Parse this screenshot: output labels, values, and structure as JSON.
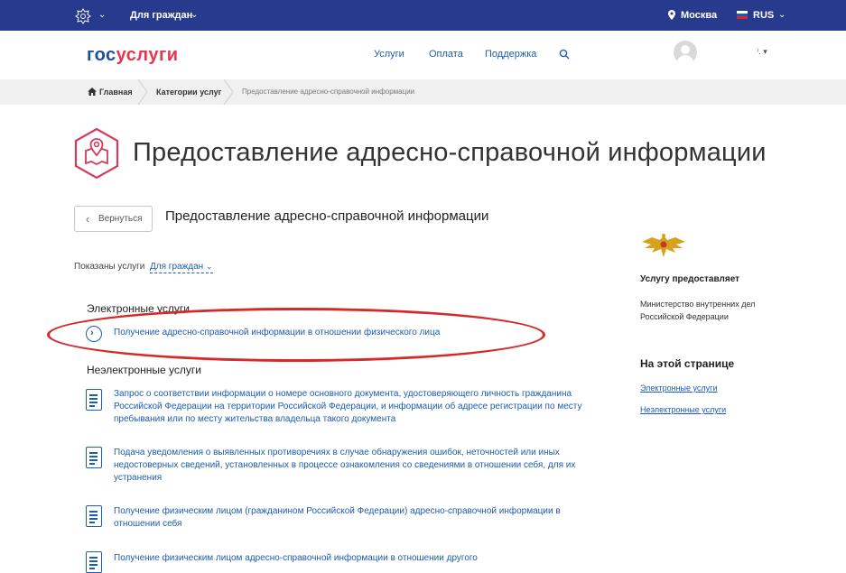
{
  "topbar": {
    "for_citizens": "Для граждан",
    "location": "Москва",
    "language": "RUS"
  },
  "header": {
    "logo_part1": "гос",
    "logo_part2": "услуги",
    "nav": [
      "Услуги",
      "Оплата",
      "Поддержка"
    ],
    "user_menu_label": "⁾."
  },
  "breadcrumb": {
    "home": "Главная",
    "categories": "Категории услуг",
    "current": "Предоставление адресно-справочной информации"
  },
  "page": {
    "title": "Предоставление адресно-справочной информации",
    "back_label": "Вернуться",
    "subtitle": "Предоставление адресно-справочной информации",
    "filter_label": "Показаны услуги",
    "filter_value": "Для граждан"
  },
  "services": {
    "electronic_heading": "Электронные услуги",
    "electronic": [
      "Получение адресно-справочной информации в отношении физического лица"
    ],
    "non_electronic_heading": "Неэлектронные услуги",
    "non_electronic": [
      "Запрос о соответствии информации о номере основного документа, удостоверяющего личность гражданина Российской Федерации на территории Российской Федерации, и информации об адресе регистрации по месту пребывания или по месту жительства владельца такого документа",
      "Подача уведомления о выявленных противоречиях в случае обнаружения ошибок, неточностей или иных недостоверных сведений, установленных в процессе ознакомления со сведениями в отношении себя, для их устранения",
      "Получение физическим лицом (гражданином Российской Федерации) адресно-справочной информации в отношении себя",
      "Получение физическим лицом адресно-справочной информации в отношении другого"
    ]
  },
  "sidebar": {
    "provides_heading": "Услугу предоставляет",
    "provider": "Министерство внутренних дел Российской Федерации",
    "on_page_heading": "На этой странице",
    "links": [
      "Электронные услуги",
      "Неэлектронные услуги"
    ]
  },
  "colors": {
    "topbar": "#273a8e",
    "link": "#1d5cae",
    "logo_red": "#e8344e",
    "annotation_oval": "#d42a2a"
  },
  "icons": [
    "russia-emblem-icon",
    "chevron-down-icon",
    "location-pin-icon",
    "flag-icon",
    "search-icon",
    "home-icon",
    "map-pin-service-icon",
    "chevron-left-icon",
    "circle-arrow-icon",
    "document-icon",
    "mvd-emblem-icon"
  ]
}
